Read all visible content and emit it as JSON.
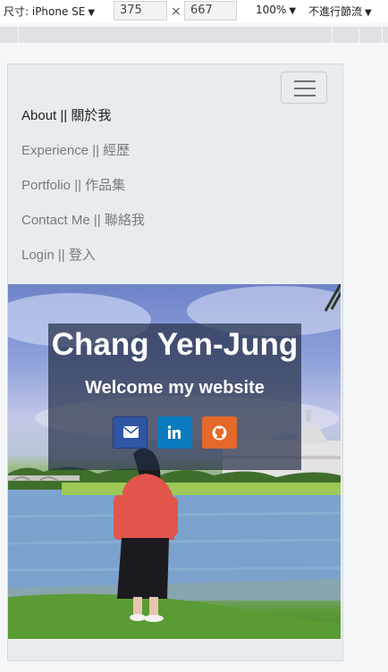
{
  "devtools": {
    "device_label": "尺寸: iPhone SE",
    "width": "375",
    "times": "×",
    "height": "667",
    "zoom": "100%",
    "throttle": "不進行節流",
    "caret": "▼"
  },
  "nav": {
    "items": [
      {
        "label": "About || 關於我",
        "active": true
      },
      {
        "label": "Experience || 經歷",
        "active": false
      },
      {
        "label": "Portfolio || 作品集",
        "active": false
      },
      {
        "label": "Contact Me || 聯絡我",
        "active": false
      },
      {
        "label": "Login || 登入",
        "active": false
      }
    ]
  },
  "hero": {
    "title": "Chang Yen-Jung",
    "subtitle": "Welcome my website",
    "social": [
      {
        "icon": "envelope-icon",
        "color": "#2f55a4"
      },
      {
        "icon": "linkedin-icon",
        "color": "#0a7bbf"
      },
      {
        "icon": "github-icon",
        "color": "#e4692a"
      }
    ]
  }
}
